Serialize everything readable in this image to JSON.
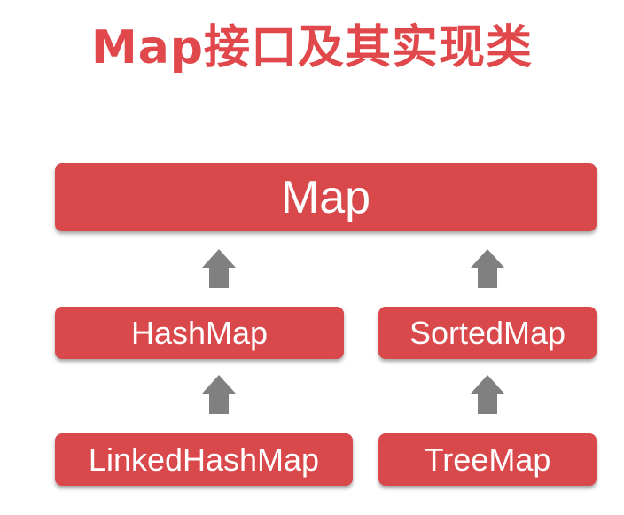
{
  "title": "Map接口及其实现类",
  "nodes": {
    "map": "Map",
    "hashmap": "HashMap",
    "sortedmap": "SortedMap",
    "linkedhashmap": "LinkedHashMap",
    "treemap": "TreeMap"
  },
  "edges": [
    {
      "from": "HashMap",
      "to": "Map"
    },
    {
      "from": "SortedMap",
      "to": "Map"
    },
    {
      "from": "LinkedHashMap",
      "to": "HashMap"
    },
    {
      "from": "TreeMap",
      "to": "SortedMap"
    }
  ],
  "colors": {
    "title": "#e0484c",
    "box": "#d9484b",
    "box_text": "#ffffff",
    "arrow": "#808080"
  },
  "icons": {
    "arrow": "arrow-up-icon"
  }
}
